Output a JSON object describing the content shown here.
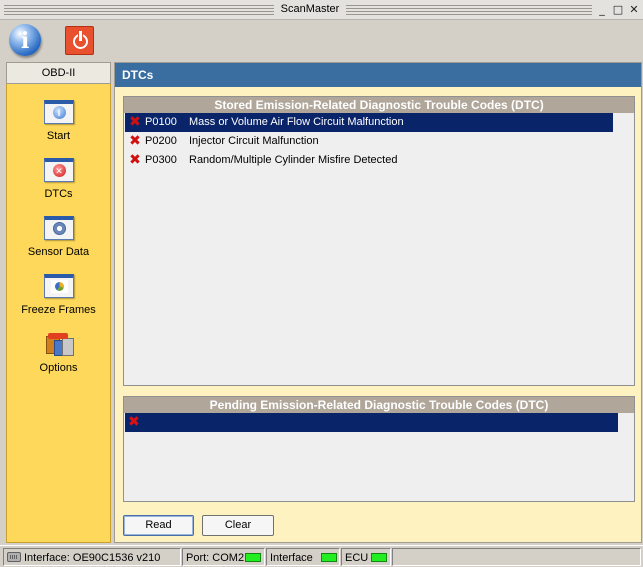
{
  "window": {
    "title": "ScanMaster",
    "controls": [
      "minimize",
      "maximize",
      "close"
    ]
  },
  "toolbar": {
    "buttons": [
      {
        "name": "info",
        "icon": "info-icon"
      },
      {
        "name": "power",
        "icon": "power-icon"
      }
    ]
  },
  "sidebar": {
    "header": "OBD-II",
    "items": [
      {
        "label": "Start",
        "icon": "start-icon"
      },
      {
        "label": "DTCs",
        "icon": "dtcs-icon"
      },
      {
        "label": "Sensor Data",
        "icon": "sensor-data-icon"
      },
      {
        "label": "Freeze Frames",
        "icon": "freeze-frames-icon"
      },
      {
        "label": "Options",
        "icon": "options-icon"
      }
    ]
  },
  "main": {
    "title": "DTCs",
    "stored": {
      "header": "Stored Emission-Related Diagnostic Trouble Codes (DTC)",
      "rows": [
        {
          "code": "P0100",
          "description": "Mass or Volume Air Flow Circuit Malfunction",
          "selected": true
        },
        {
          "code": "P0200",
          "description": "Injector Circuit Malfunction",
          "selected": false
        },
        {
          "code": "P0300",
          "description": "Random/Multiple Cylinder Misfire Detected",
          "selected": false
        }
      ]
    },
    "pending": {
      "header": "Pending Emission-Related Diagnostic Trouble Codes (DTC)"
    },
    "buttons": {
      "read": "Read",
      "clear": "Clear"
    }
  },
  "statusbar": {
    "interface": "Interface: OE90C1536 v210",
    "port": "Port: COM2",
    "interface_status": "Interface",
    "ecu": "ECU"
  },
  "colors": {
    "accent_header": "#3a6ea0",
    "sidebar_bg": "#fdd85a",
    "panel_bg": "#fdf2c0",
    "selection": "#0a246a",
    "status_ok": "#22ee22",
    "error_x": "#d01010"
  }
}
